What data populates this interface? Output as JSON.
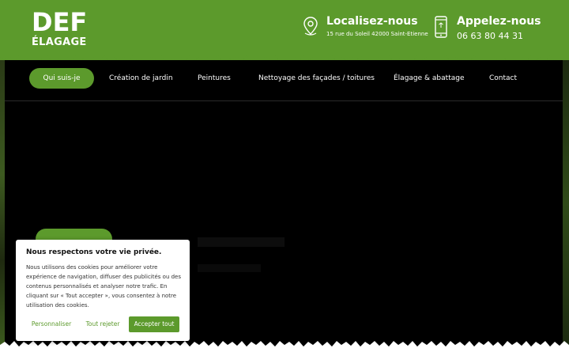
{
  "header": {
    "logo_main": "DEF",
    "logo_sub": "ÉLAGAGE",
    "location_title": "Localisez-nous",
    "location_address": "15 rue du Soleil 42000 Saint-Etienne",
    "phone_title": "Appelez-nous",
    "phone_number": "06 63 80 44 31",
    "icons": {
      "location": "location-pin-icon",
      "phone": "smartphone-icon"
    }
  },
  "nav": {
    "items": [
      {
        "label": "Qui suis-je",
        "active": true
      },
      {
        "label": "Création de jardin"
      },
      {
        "label": "Peintures"
      },
      {
        "label": "Nettoyage des façades / toitures"
      },
      {
        "label": "Élagage & abattage"
      },
      {
        "label": "Contact"
      }
    ]
  },
  "cookie_banner": {
    "title": "Nous respectons votre vie privée.",
    "text": "Nous utilisons des cookies pour améliorer votre expérience de navigation, diffuser des publicités ou des contenus personnalisés et analyser notre trafic. En cliquant sur « Tout accepter », vous consentez à notre utilisation des cookies.",
    "customize_label": "Personnaliser",
    "reject_label": "Tout rejeter",
    "accept_label": "Accepter tout"
  },
  "colors": {
    "brand_green": "#5c9a2c",
    "hero_background": "#000000",
    "header_text": "#ffffff"
  }
}
